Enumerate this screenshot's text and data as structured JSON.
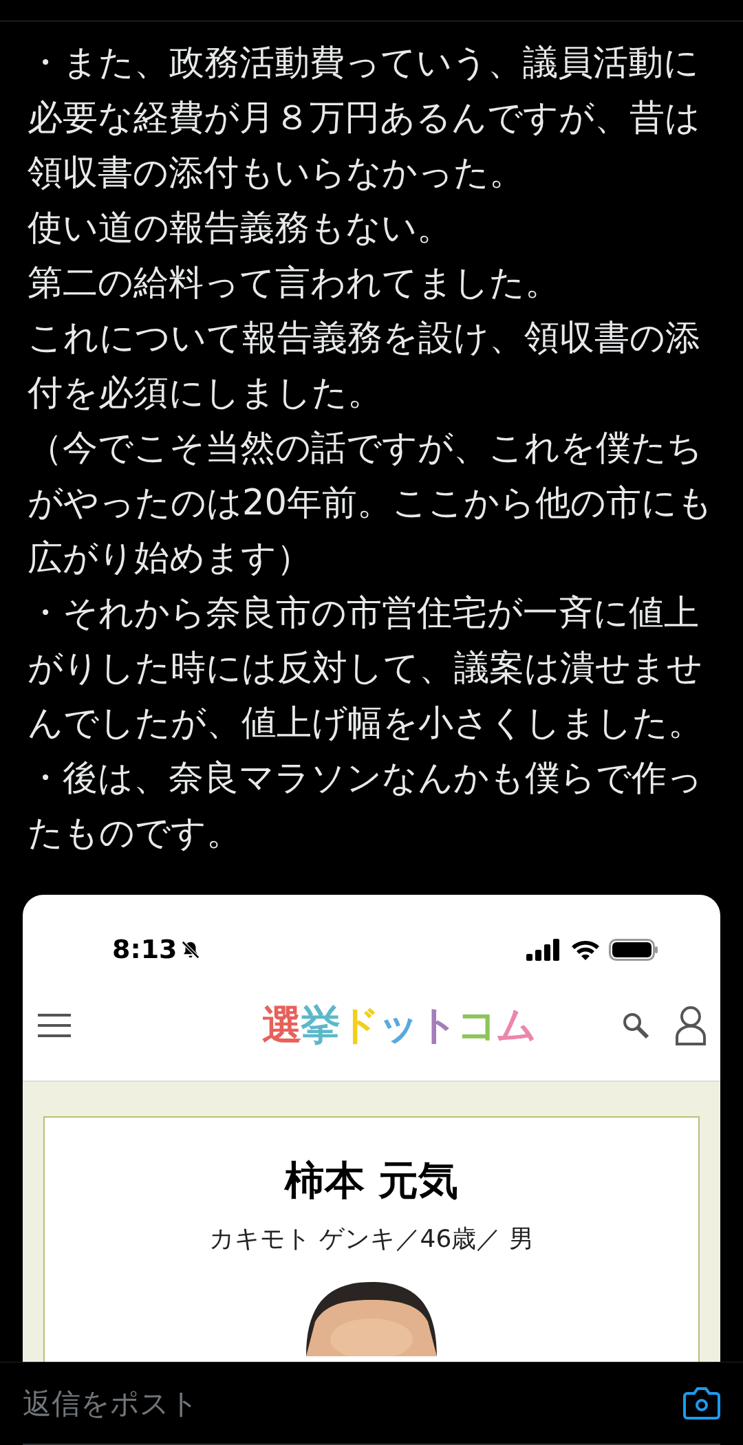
{
  "post": {
    "paragraphs": [
      "・また、政務活動費っていう、議員活動に必要な経費が月８万円あるんですが、昔は領収書の添付もいらなかった。",
      "使い道の報告義務もない。",
      "第二の給料って言われてました。",
      "これについて報告義務を設け、領収書の添付を必須にしました。",
      "（今でこそ当然の話ですが、これを僕たちがやったのは20年前。ここから他の市にも広がり始めます）",
      "・それから奈良市の市営住宅が一斉に値上がりした時には反対して、議案は潰せませんでしたが、値上げ幅を小さくしました。",
      "・後は、奈良マラソンなんかも僕らで作ったものです。"
    ]
  },
  "embedded_screenshot": {
    "status_bar": {
      "time": "8:13"
    },
    "header": {
      "logo": "選挙ドットコム"
    },
    "profile": {
      "name": "柿本 元気",
      "details": "カキモト ゲンキ／46歳／ 男"
    }
  },
  "reply_bar": {
    "placeholder": "返信をポスト"
  }
}
